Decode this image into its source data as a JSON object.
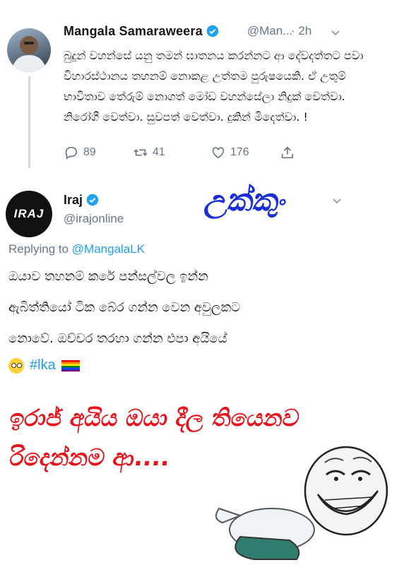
{
  "tweet1": {
    "name": "Mangala Samaraweera",
    "handle": "@Man...",
    "time": "· 2h",
    "text": "බුදුන් වහන්සේ යනු තමන් ඝාතනය කරන්නට ආ දේවදත්තට පවා විහාරස්ථානය තහනම් නොකළ උත්තම පුරුෂයෙකි. ඒ උතුම් භාවිතාව තේරුම් නොගත් මෝඩ වහන්සේලා නිදුක් වෙත්වා. නිරෝගී වෙත්වා. සුවපත් වෙත්වා. දුකින් මිදෙත්වා. !",
    "replies": "89",
    "retweets": "41",
    "likes": "176"
  },
  "tweet2": {
    "avatar_text": "IRAJ",
    "name": "Iraj",
    "handle": "@irajonline",
    "replying_prefix": "Replying to",
    "replying_to": "@MangalaLK",
    "line1": "ඔයාව තහනම් කරේ පන්සල්වල ඉන්න",
    "line2": "ඇබිත්තියෝ ටික බේර ගන්න වෙන අවුලකට",
    "line3": "නොවේ. ඔච්චර තරහා ගන්න එපා අයියේ",
    "hashtag": "#lka"
  },
  "overlay": {
    "ukkum": "උක්කුං",
    "red_line1": "ඉරාජ් අයිය ඔයා දීල තියෙනව",
    "red_line2": "රිදෙන්නම ආ...."
  },
  "colors": {
    "accent": "#1da1f2",
    "overlay_blue": "#1a2fd6",
    "overlay_red": "#e8141c"
  },
  "icons": [
    "verified-badge-icon",
    "reply-icon",
    "retweet-icon",
    "like-icon",
    "share-icon",
    "chevron-down-icon"
  ]
}
